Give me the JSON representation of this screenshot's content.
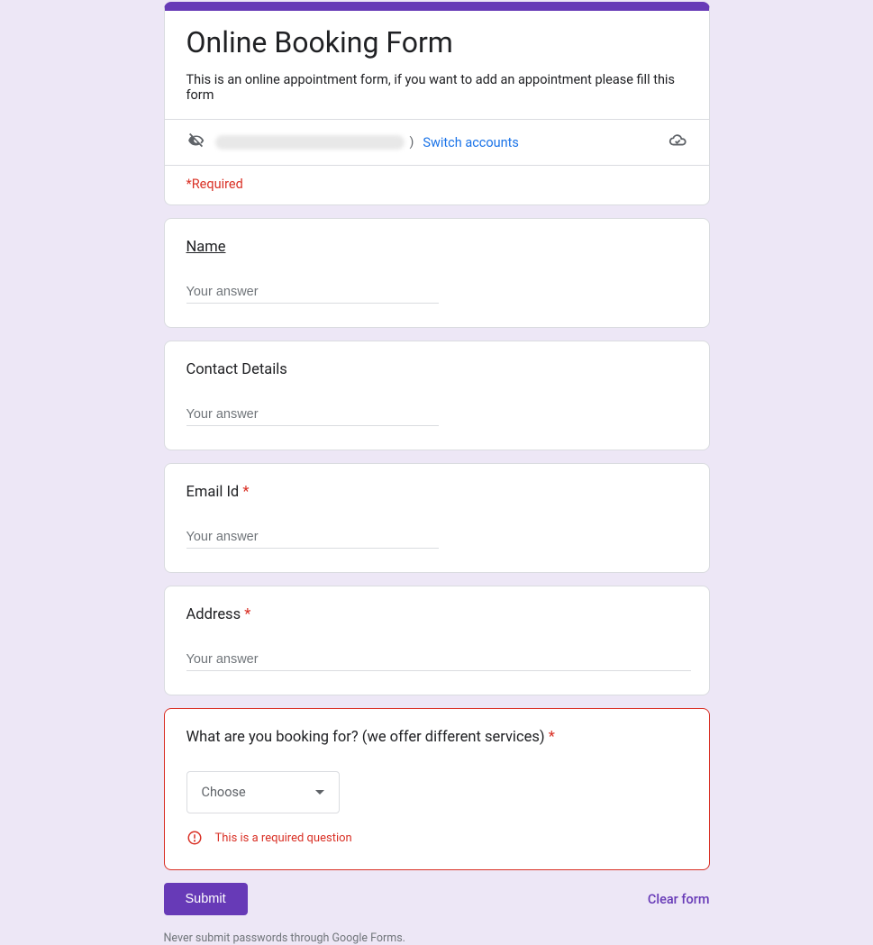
{
  "header": {
    "title": "Online Booking Form",
    "description": "This is an online appointment form, if you want to add an appointment please fill this form",
    "switch_accounts": "Switch accounts",
    "paren": ")",
    "required_note": "*Required"
  },
  "questions": {
    "name": {
      "label": "Name",
      "placeholder": "Your answer"
    },
    "contact": {
      "label": "Contact Details",
      "placeholder": "Your answer"
    },
    "email": {
      "label": "Email Id",
      "placeholder": "Your answer"
    },
    "address": {
      "label": "Address",
      "placeholder": "Your answer"
    },
    "service": {
      "label": "What are you booking for? (we offer different services)",
      "choose": "Choose",
      "error": "This is a required question"
    }
  },
  "footer": {
    "submit": "Submit",
    "clear": "Clear form",
    "disclaimer": "Never submit passwords through Google Forms."
  }
}
